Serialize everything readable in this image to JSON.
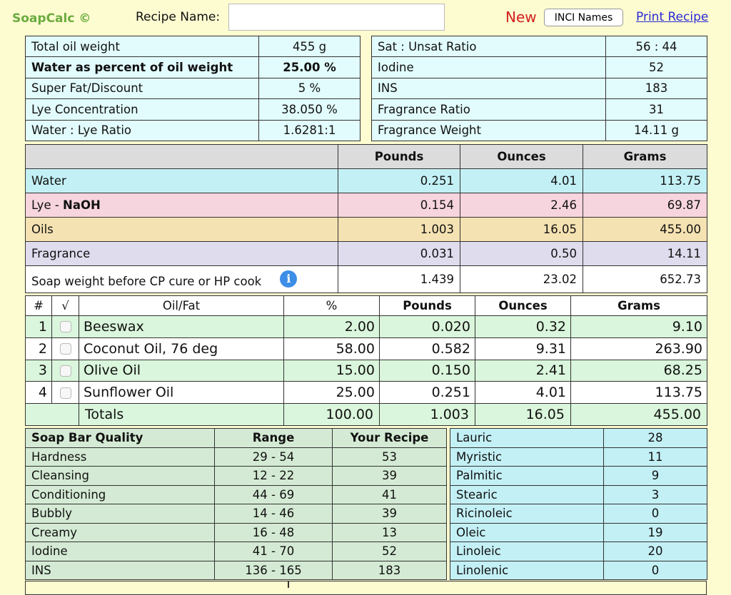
{
  "header": {
    "logo": "SoapCalc ©",
    "recipe_label": "Recipe Name:",
    "recipe_value": "",
    "new_label": "New",
    "inci_button": "INCI Names",
    "print_link": "Print Recipe"
  },
  "params_left": [
    {
      "label": "Total oil weight",
      "value": "455 g",
      "bold": false
    },
    {
      "label": "Water as percent of oil weight",
      "value": "25.00 %",
      "bold": true
    },
    {
      "label": "Super Fat/Discount",
      "value": "5 %",
      "bold": false
    },
    {
      "label": "Lye Concentration",
      "value": "38.050 %",
      "bold": false
    },
    {
      "label": "Water : Lye Ratio",
      "value": "1.6281:1",
      "bold": false
    }
  ],
  "params_right": [
    {
      "label": "Sat : Unsat Ratio",
      "value": "56 : 44"
    },
    {
      "label": "Iodine",
      "value": "52"
    },
    {
      "label": "INS",
      "value": "183"
    },
    {
      "label": "Fragrance Ratio",
      "value": "31"
    },
    {
      "label": "Fragrance Weight",
      "value": "14.11 g"
    }
  ],
  "weights": {
    "headers": [
      "",
      "Pounds",
      "Ounces",
      "Grams"
    ],
    "water": {
      "label": "Water",
      "pounds": "0.251",
      "ounces": "4.01",
      "grams": "113.75"
    },
    "lye": {
      "label_prefix": "Lye - ",
      "label_bold": "NaOH",
      "pounds": "0.154",
      "ounces": "2.46",
      "grams": "69.87"
    },
    "oils": {
      "label": "Oils",
      "pounds": "1.003",
      "ounces": "16.05",
      "grams": "455.00"
    },
    "fragrance": {
      "label": "Fragrance",
      "pounds": "0.031",
      "ounces": "0.50",
      "grams": "14.11"
    },
    "soap": {
      "label": "Soap weight before CP cure or HP cook",
      "info": "i",
      "pounds": "1.439",
      "ounces": "23.02",
      "grams": "652.73"
    }
  },
  "oils": {
    "headers": {
      "num": "#",
      "check": "√",
      "name": "Oil/Fat",
      "pct": "%",
      "pounds": "Pounds",
      "ounces": "Ounces",
      "grams": "Grams"
    },
    "rows": [
      {
        "num": "1",
        "name": "Beeswax",
        "pct": "2.00",
        "pounds": "0.020",
        "ounces": "0.32",
        "grams": "9.10"
      },
      {
        "num": "2",
        "name": "Coconut Oil, 76 deg",
        "pct": "58.00",
        "pounds": "0.582",
        "ounces": "9.31",
        "grams": "263.90"
      },
      {
        "num": "3",
        "name": "Olive Oil",
        "pct": "15.00",
        "pounds": "0.150",
        "ounces": "2.41",
        "grams": "68.25"
      },
      {
        "num": "4",
        "name": "Sunflower Oil",
        "pct": "25.00",
        "pounds": "0.251",
        "ounces": "4.01",
        "grams": "113.75"
      }
    ],
    "totals": {
      "label": "Totals",
      "pct": "100.00",
      "pounds": "1.003",
      "ounces": "16.05",
      "grams": "455.00"
    }
  },
  "quality": {
    "headers": [
      "Soap Bar Quality",
      "Range",
      "Your Recipe"
    ],
    "rows": [
      {
        "label": "Hardness",
        "range": "29 - 54",
        "value": "53"
      },
      {
        "label": "Cleansing",
        "range": "12 - 22",
        "value": "39"
      },
      {
        "label": "Conditioning",
        "range": "44 - 69",
        "value": "41"
      },
      {
        "label": "Bubbly",
        "range": "14 - 46",
        "value": "39"
      },
      {
        "label": "Creamy",
        "range": "16 - 48",
        "value": "13"
      },
      {
        "label": "Iodine",
        "range": "41 - 70",
        "value": "52"
      },
      {
        "label": "INS",
        "range": "136 - 165",
        "value": "183"
      }
    ]
  },
  "acids": [
    {
      "label": "Lauric",
      "value": "28"
    },
    {
      "label": "Myristic",
      "value": "11"
    },
    {
      "label": "Palmitic",
      "value": "9"
    },
    {
      "label": "Stearic",
      "value": "3"
    },
    {
      "label": "Ricinoleic",
      "value": "0"
    },
    {
      "label": "Oleic",
      "value": "19"
    },
    {
      "label": "Linoleic",
      "value": "20"
    },
    {
      "label": "Linolenic",
      "value": "0"
    }
  ]
}
